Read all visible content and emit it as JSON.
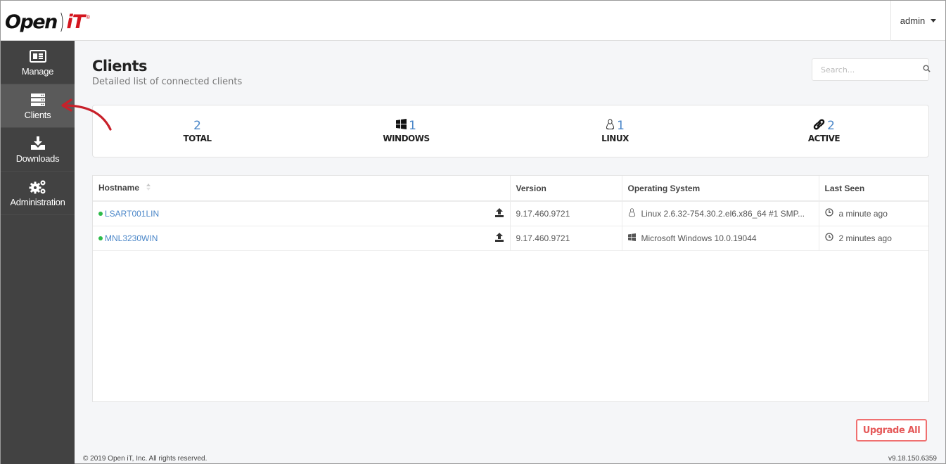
{
  "header": {
    "logo_part1": "Open",
    "logo_part2": "iT",
    "logo_reg": "®",
    "user_label": "admin"
  },
  "sidebar": {
    "items": [
      {
        "label": "Manage",
        "icon": "newspaper-icon",
        "active": false
      },
      {
        "label": "Clients",
        "icon": "server-icon",
        "active": true
      },
      {
        "label": "Downloads",
        "icon": "download-icon",
        "active": false
      },
      {
        "label": "Administration",
        "icon": "gears-icon",
        "active": false
      }
    ]
  },
  "page": {
    "title": "Clients",
    "subtitle": "Detailed list of connected clients",
    "search_placeholder": "Search..."
  },
  "stats": [
    {
      "value": "2",
      "label": "TOTAL",
      "icon": ""
    },
    {
      "value": "1",
      "label": "WINDOWS",
      "icon": "windows-icon"
    },
    {
      "value": "1",
      "label": "LINUX",
      "icon": "linux-icon"
    },
    {
      "value": "2",
      "label": "ACTIVE",
      "icon": "link-icon"
    }
  ],
  "table": {
    "columns": [
      "Hostname",
      "Version",
      "Operating System",
      "Last Seen"
    ],
    "rows": [
      {
        "hostname": "LSART001LIN",
        "status": "online",
        "version": "9.17.460.9721",
        "os": "Linux 2.6.32-754.30.2.el6.x86_64 #1 SMP...",
        "os_icon": "linux-icon",
        "last_seen": "a minute ago"
      },
      {
        "hostname": "MNL3230WIN",
        "status": "online",
        "version": "9.17.460.9721",
        "os": "Microsoft Windows 10.0.19044",
        "os_icon": "windows-icon",
        "last_seen": "2 minutes ago"
      }
    ]
  },
  "actions": {
    "upgrade_all": "Upgrade All"
  },
  "footer": {
    "copyright": "© 2019 Open iT, Inc. All rights reserved.",
    "version": "v9.18.150.6359"
  },
  "colors": {
    "accent": "#4a86c8",
    "brand_red": "#d4161f",
    "online": "#2dbb4a",
    "upgrade": "#e55a5a",
    "sidebar": "#424242"
  }
}
